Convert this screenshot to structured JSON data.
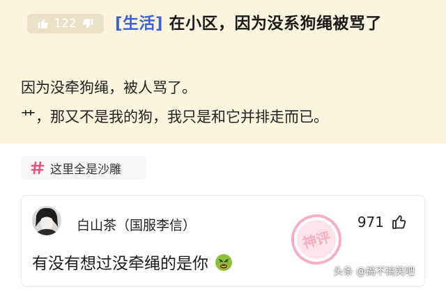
{
  "post": {
    "vote_count": "122",
    "title_tag": "[生活]",
    "title": " 在小区，因为没系狗绳被骂了",
    "body_lines": [
      "因为没牵狗绳，被人骂了。",
      "艹，那又不是我的狗，我只是和它并排走而已。"
    ]
  },
  "circle": {
    "label": "这里全是沙雕",
    "icon": "hash-icon"
  },
  "comment": {
    "username": "白山茶（国服李信）",
    "like_count": "971",
    "text": "有没有想过没牵绳的是你",
    "emoji": "nauseated-face",
    "stamp_text": "神评"
  },
  "watermark": "头条 @搞不搞笑吧",
  "colors": {
    "post_bg": "#fcf4de",
    "tag_blue": "#3b60d8",
    "circle_pink": "#f04e7a",
    "stamp_pink": "#f7a0b8"
  }
}
